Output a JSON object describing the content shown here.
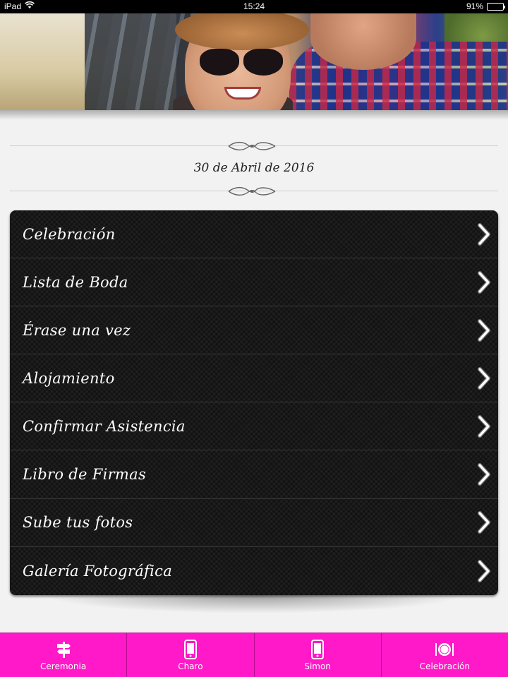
{
  "status_bar": {
    "device": "iPad",
    "time": "15:24",
    "battery": "91%",
    "battery_level": 0.91
  },
  "event_date": "30 de Abril de 2016",
  "menu": {
    "items": [
      {
        "label": "Celebración"
      },
      {
        "label": "Lista de Boda"
      },
      {
        "label": "Érase una vez"
      },
      {
        "label": "Alojamiento"
      },
      {
        "label": "Confirmar Asistencia"
      },
      {
        "label": "Libro de Firmas"
      },
      {
        "label": "Sube tus fotos"
      },
      {
        "label": "Galería Fotográfica"
      }
    ]
  },
  "tab_bar": {
    "background": "#ff19c8",
    "tabs": [
      {
        "label": "Ceremonia",
        "icon": "signpost-icon"
      },
      {
        "label": "Charo",
        "icon": "phone-icon"
      },
      {
        "label": "Simon",
        "icon": "phone-icon"
      },
      {
        "label": "Celebración",
        "icon": "dinner-plate-icon"
      }
    ]
  }
}
